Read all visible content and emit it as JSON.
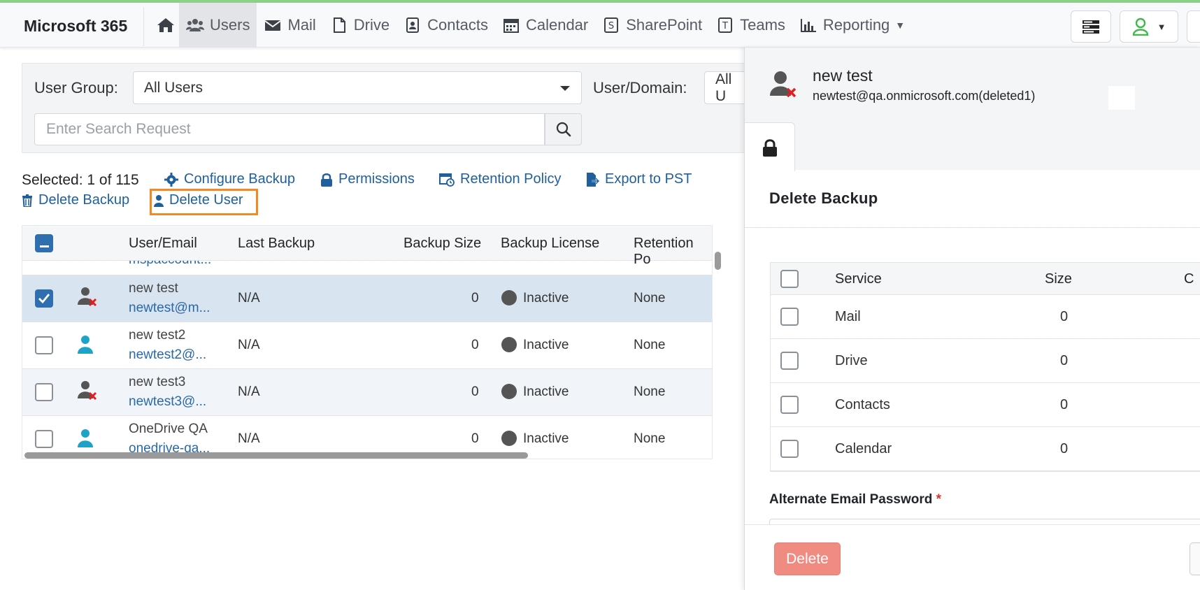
{
  "navbar": {
    "brand": "Microsoft 365",
    "items": [
      {
        "label": "Users",
        "icon": "users-icon"
      },
      {
        "label": "Mail",
        "icon": "envelope-icon"
      },
      {
        "label": "Drive",
        "icon": "file-icon"
      },
      {
        "label": "Contacts",
        "icon": "contact-card-icon"
      },
      {
        "label": "Calendar",
        "icon": "calendar-icon"
      },
      {
        "label": "SharePoint",
        "icon": "sharepoint-icon"
      },
      {
        "label": "Teams",
        "icon": "teams-icon"
      },
      {
        "label": "Reporting",
        "icon": "bar-chart-icon"
      }
    ]
  },
  "filters": {
    "group_label": "User Group:",
    "group_value": "All Users",
    "domain_label": "User/Domain:",
    "domain_value": "All U",
    "search_placeholder": "Enter Search Request"
  },
  "toolbar": {
    "selected": "Selected: 1 of 115",
    "configure_backup": "Configure Backup",
    "permissions": "Permissions",
    "retention_policy": "Retention Policy",
    "export_to_pst": "Export to PST",
    "delete_backup": "Delete Backup",
    "delete_user": "Delete User"
  },
  "table": {
    "headers": {
      "user_email": "User/Email",
      "last_backup": "Last Backup",
      "backup_size": "Backup Size",
      "backup_license": "Backup License",
      "retention_policy": "Retention Po"
    },
    "partial_row_email": "mspaccount...",
    "rows": [
      {
        "name": "new test",
        "email": "newtest@m...",
        "last_backup": "N/A",
        "size": "0",
        "license": "Inactive",
        "retention": "None",
        "checked": true,
        "deleted": true
      },
      {
        "name": "new test2",
        "email": "newtest2@...",
        "last_backup": "N/A",
        "size": "0",
        "license": "Inactive",
        "retention": "None",
        "checked": false,
        "deleted": false
      },
      {
        "name": "new test3",
        "email": "newtest3@...",
        "last_backup": "N/A",
        "size": "0",
        "license": "Inactive",
        "retention": "None",
        "checked": false,
        "deleted": true
      },
      {
        "name": "OneDrive QA",
        "email": "onedrive-qa...",
        "last_backup": "N/A",
        "size": "0",
        "license": "Inactive",
        "retention": "None",
        "checked": false,
        "deleted": false
      }
    ]
  },
  "panel": {
    "user_name": "new test",
    "user_email": "newtest@qa.onmicrosoft.com(deleted1)",
    "title": "Delete Backup",
    "headers": {
      "service": "Service",
      "size": "Size",
      "extra": "C"
    },
    "services": [
      {
        "name": "Mail",
        "size": "0"
      },
      {
        "name": "Drive",
        "size": "0"
      },
      {
        "name": "Contacts",
        "size": "0"
      },
      {
        "name": "Calendar",
        "size": "0"
      }
    ],
    "alt_password_label": "Alternate Email Password",
    "required_mark": "*",
    "delete_button": "Delete"
  },
  "colors": {
    "link": "#1f5f9e",
    "selected_row": "#d8e4ef",
    "highlight_border": "#f08a24",
    "delete_button": "#f08b82",
    "user_icon_active": "#1ea3c6",
    "user_icon_deleted": "#555555",
    "deleted_mark": "#e02020"
  }
}
